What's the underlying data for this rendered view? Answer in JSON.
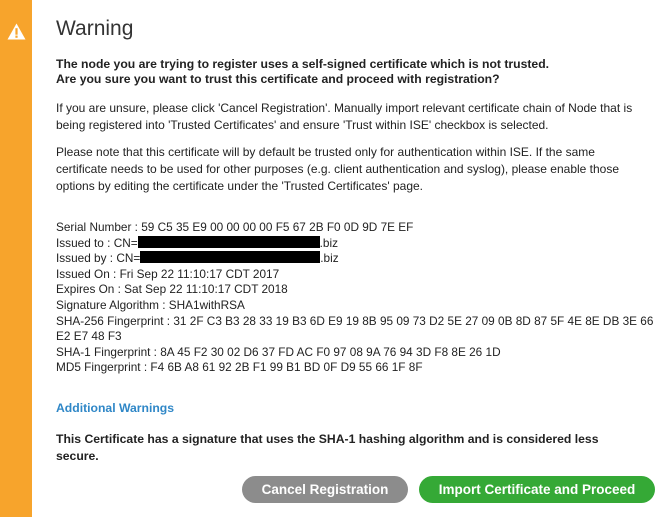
{
  "dialog": {
    "title": "Warning",
    "question_line1": "The node you are trying to register uses a self-signed certificate which is not trusted.",
    "question_line2": "Are you sure you want to trust this certificate and proceed with registration?",
    "paragraph1_line1": "If you are unsure, please click 'Cancel Registration'. Manually import relevant certificate chain of Node that is",
    "paragraph1_line2": "being registered into 'Trusted Certificates' and ensure 'Trust within ISE' checkbox is selected.",
    "paragraph2_line1": "Please note that this certificate will by default be trusted only for authentication within ISE. If the same",
    "paragraph2_line2": "certificate needs to be used for other purposes (e.g. client authentication and syslog), please enable those",
    "paragraph2_line3": "options by editing the certificate under the 'Trusted Certificates' page."
  },
  "certificate": {
    "serial_number": "Serial Number : 59 C5 35 E9 00 00 00 00 F5 67 2B F0 0D 9D 7E EF",
    "issued_to_prefix": "Issued to : CN=",
    "issued_to_suffix": ".biz",
    "issued_by_prefix": "Issued by : CN=",
    "issued_by_suffix": ".biz",
    "issued_on": "Issued On : Fri Sep 22 11:10:17 CDT 2017",
    "expires_on": "Expires On : Sat Sep 22 11:10:17 CDT 2018",
    "signature_algorithm": "Signature Algorithm : SHA1withRSA",
    "sha256_line1": "SHA-256 Fingerprint : 31 2F C3 B3 28 33 19 B3 6D E9 19 8B 95 09 73 D2 5E 27 09 0B 8D 87 5F 4E 8E DB 3E 66",
    "sha256_line2": "E2 E7 48 F3",
    "sha1": "SHA-1 Fingerprint : 8A 45 F2 30 02 D6 37 FD AC F0 97 08 9A 76 94 3D F8 8E 26 1D",
    "md5": "MD5 Fingerprint : F4 6B A8 61 92 2B F1 99 B1 BD 0F D9 55 66 1F 8F"
  },
  "additional_warnings": {
    "title": "Additional Warnings",
    "message_line1": "This Certificate has a signature that uses the SHA-1 hashing algorithm and is considered less",
    "message_line2": "secure."
  },
  "buttons": {
    "cancel_label": "Cancel Registration",
    "import_label": "Import Certificate and Proceed"
  },
  "icons": {
    "warning": "warning-triangle-icon"
  },
  "colors": {
    "stripe": "#f7a42c",
    "link_blue": "#2f87c7",
    "cancel_button": "#8c8c8c",
    "import_button": "#35a936"
  }
}
